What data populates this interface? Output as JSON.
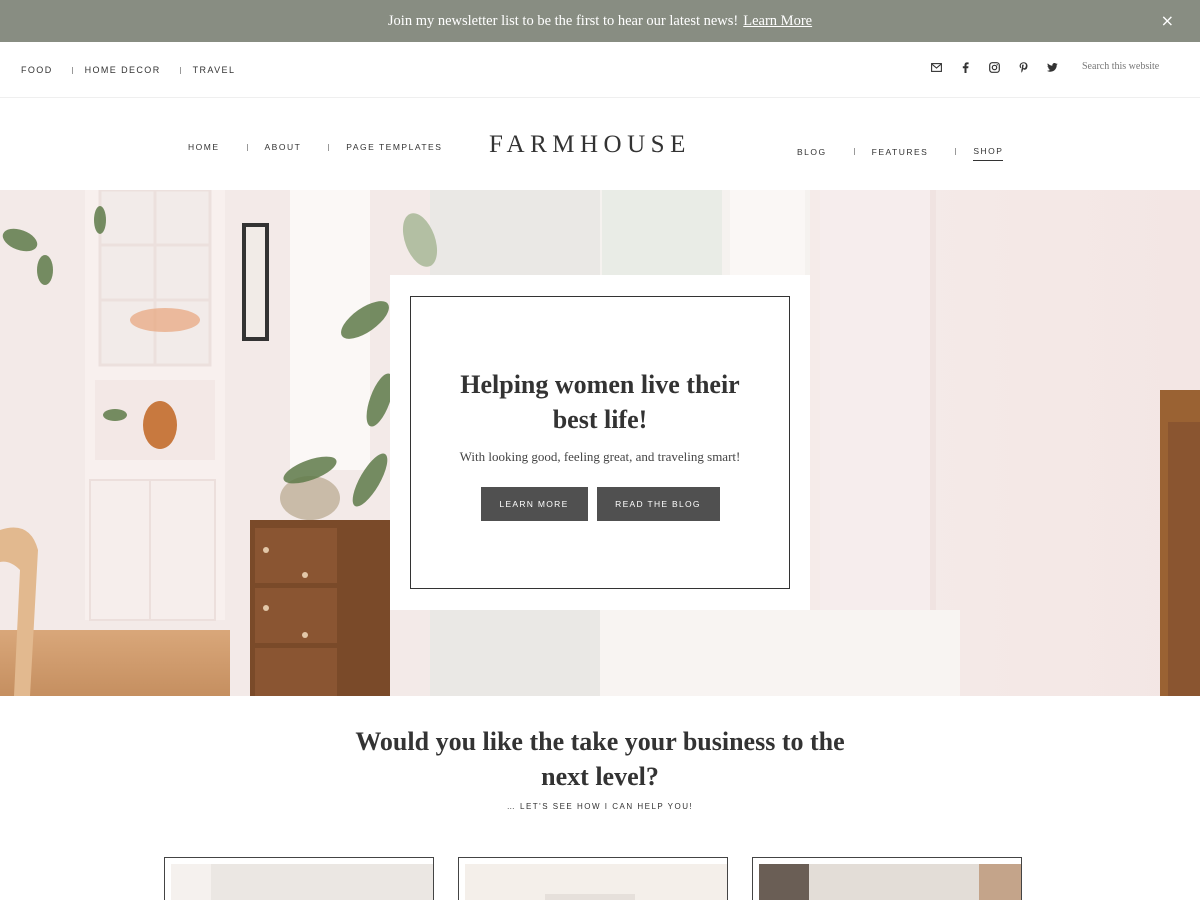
{
  "announcement": {
    "text": "Join my newsletter list to be the first to hear our latest news!",
    "link": "Learn More",
    "close": "×"
  },
  "topnav": {
    "items": [
      "FOOD",
      "HOME DECOR",
      "TRAVEL"
    ]
  },
  "social": {
    "icons": [
      "email-icon",
      "facebook-icon",
      "instagram-icon",
      "pinterest-icon",
      "twitter-icon"
    ]
  },
  "search": {
    "placeholder": "Search this website"
  },
  "header": {
    "logo": "FARMHOUSE",
    "left_nav": [
      "HOME",
      "ABOUT",
      "PAGE TEMPLATES"
    ],
    "right_nav": [
      "BLOG",
      "FEATURES",
      "SHOP"
    ],
    "active": "SHOP"
  },
  "hero": {
    "title": "Helping women live their best life!",
    "subtitle": "With looking good, feeling great, and traveling smart!",
    "button_primary": "LEARN MORE",
    "button_secondary": "READ THE BLOG"
  },
  "section": {
    "title": "Would you like the take your business to the next level?",
    "subtitle": "… LET'S SEE HOW I CAN HELP YOU!"
  },
  "colors": {
    "announcement_bg": "#888d82",
    "button_bg": "#505050",
    "text": "#333333"
  }
}
